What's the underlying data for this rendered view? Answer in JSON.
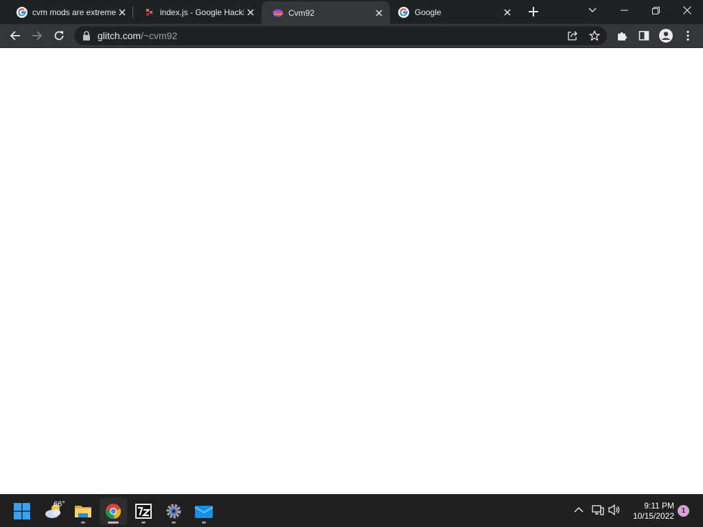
{
  "browser": {
    "tabs": [
      {
        "title": "cvm mods are extremely",
        "favicon": "google-g-icon",
        "active": false
      },
      {
        "title": "index.js - Google Hacking",
        "favicon": "glitch-fish-icon",
        "active": false
      },
      {
        "title": "Cvm92",
        "favicon": "cvm92-icon",
        "active": true
      },
      {
        "title": "Google",
        "favicon": "google-g-icon",
        "active": false
      }
    ],
    "url_host": "glitch.com",
    "url_path": "/~cvm92"
  },
  "taskbar": {
    "weather_temp": "66°",
    "clock_time": "9:11 PM",
    "clock_date": "10/15/2022",
    "notification_count": "1"
  },
  "colors": {
    "tabstrip": "#202124",
    "toolbar": "#35363a",
    "taskbar": "#202020",
    "page_background": "#ffffff"
  }
}
